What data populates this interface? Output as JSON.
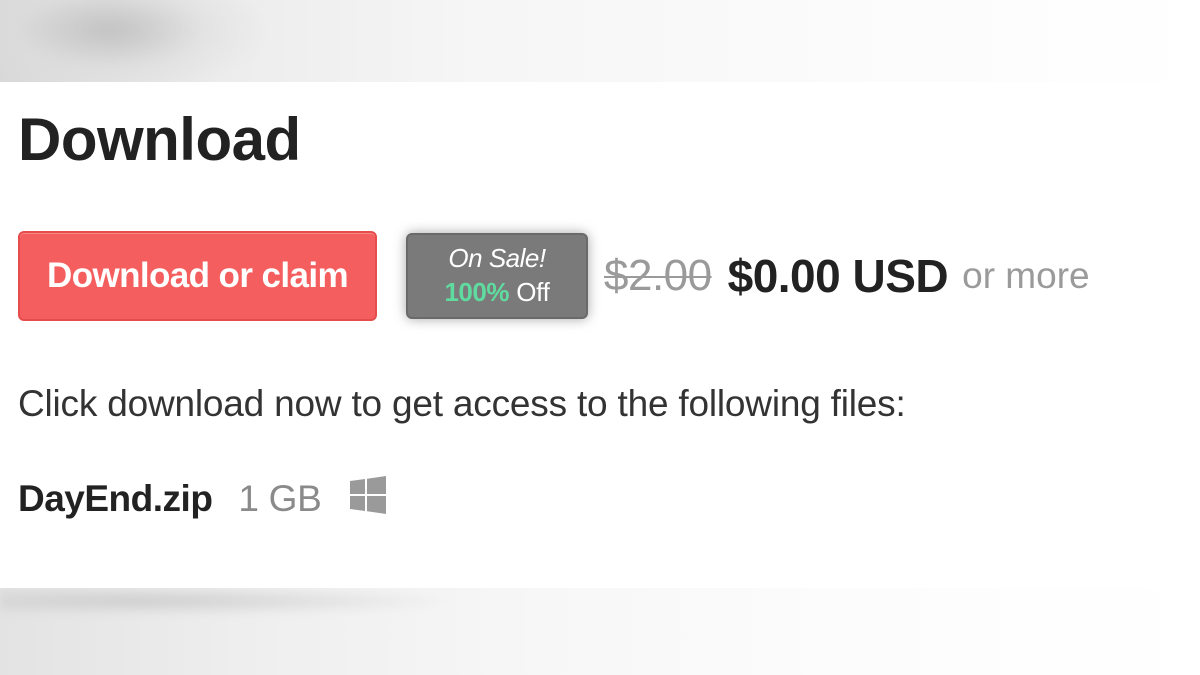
{
  "section": {
    "title": "Download"
  },
  "purchase": {
    "button_label": "Download or claim",
    "sale_badge": {
      "headline": "On Sale!",
      "percent": "100%",
      "off_label": "Off"
    },
    "original_price": "$2.00",
    "current_price": "$0.00 USD",
    "or_more": "or more"
  },
  "instructions": "Click download now to get access to the following files:",
  "files": [
    {
      "name": "DayEnd.zip",
      "size": "1 GB",
      "platform_icon": "windows-icon"
    }
  ],
  "colors": {
    "button_bg": "#f55e5e",
    "badge_bg": "#7a7a7a",
    "sale_percent": "#5fdb9f",
    "muted_text": "#9a9a9a"
  }
}
